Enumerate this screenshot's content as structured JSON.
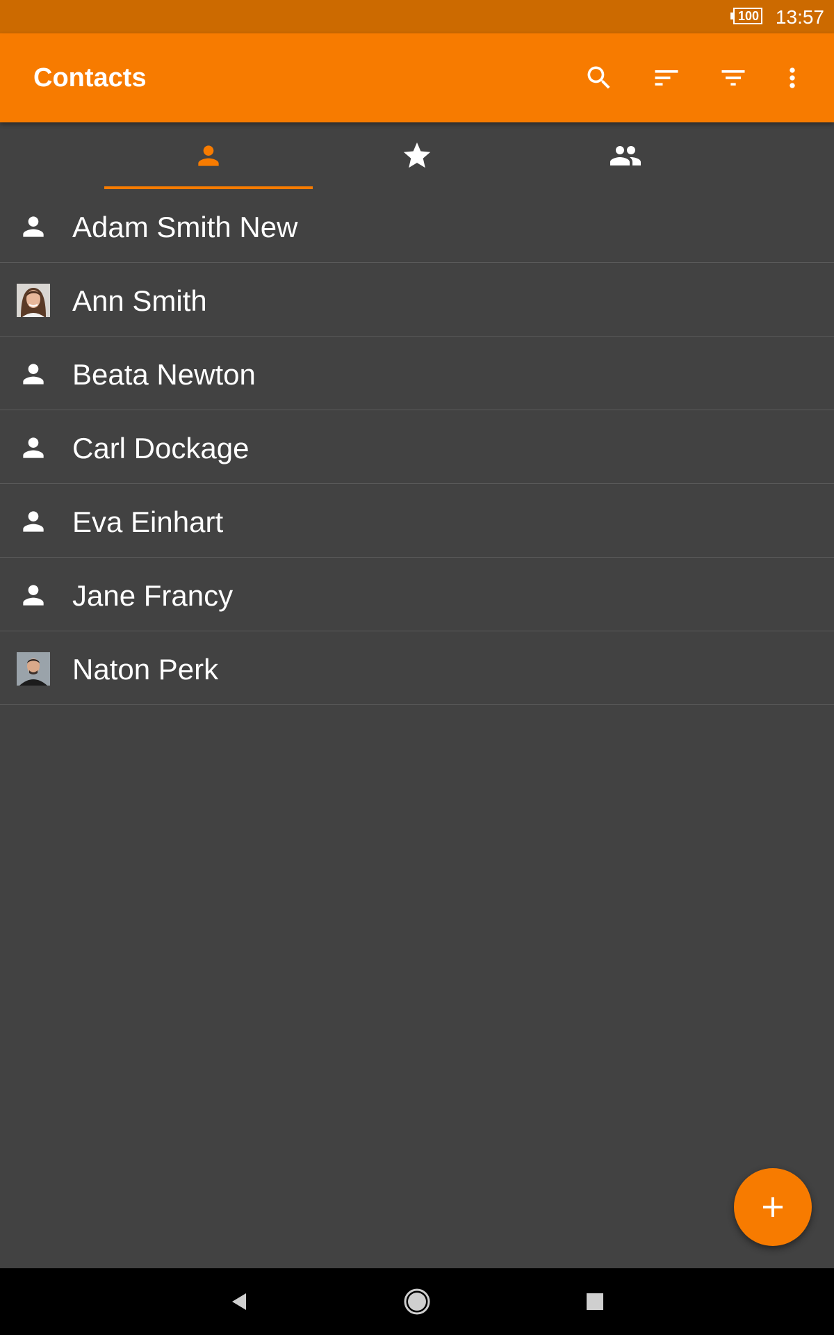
{
  "status_bar": {
    "battery_level": "100",
    "time": "13:57"
  },
  "app_bar": {
    "title": "Contacts",
    "actions": [
      "search-icon",
      "sort-icon",
      "filter-icon",
      "more-vert-icon"
    ]
  },
  "tabs": [
    {
      "icon": "person-icon",
      "selected": true
    },
    {
      "icon": "star-icon",
      "selected": false
    },
    {
      "icon": "group-icon",
      "selected": false
    }
  ],
  "contacts": [
    {
      "name": "Adam Smith New",
      "avatar": "person-icon"
    },
    {
      "name": "Ann Smith",
      "avatar": "photo"
    },
    {
      "name": "Beata Newton",
      "avatar": "person-icon"
    },
    {
      "name": "Carl Dockage",
      "avatar": "person-icon"
    },
    {
      "name": "Eva Einhart",
      "avatar": "person-icon"
    },
    {
      "name": "Jane Francy",
      "avatar": "person-icon"
    },
    {
      "name": "Naton Perk",
      "avatar": "photo"
    }
  ],
  "fab": {
    "icon": "add-icon"
  },
  "colors": {
    "primary": "#f77b00",
    "primary_dark": "#cc6a00",
    "background": "#424242",
    "divider": "#5a5a5a",
    "text": "#ffffff"
  }
}
